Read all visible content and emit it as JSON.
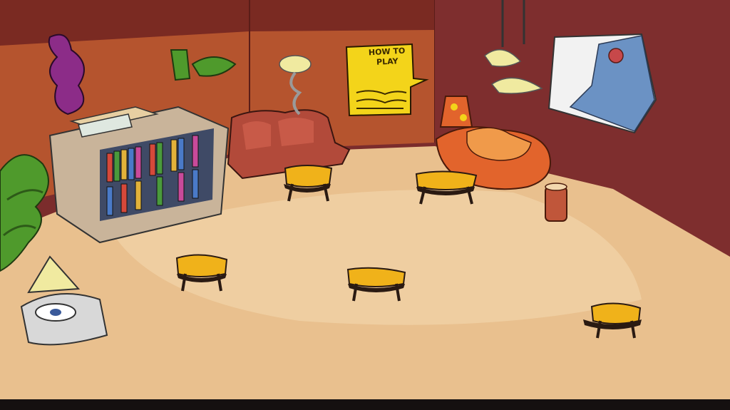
{
  "scene": {
    "name": "game-room",
    "colors": {
      "wall_back": "#b5542e",
      "wall_dark": "#7a2a22",
      "wall_maroon": "#7b2c2c",
      "floor": "#e9c08e",
      "floor_light": "#f3d7ae",
      "poster": "#f3d41a",
      "couch": "#b24a3a",
      "stool_top": "#f0b21a",
      "stool_leg": "#2a1a12",
      "lamp_shade": "#f0eaa0",
      "plant": "#4f9a2c"
    }
  },
  "poster": {
    "title_line1": "HOW TO",
    "title_line2": "PLAY"
  },
  "tables": {
    "count": 5
  }
}
